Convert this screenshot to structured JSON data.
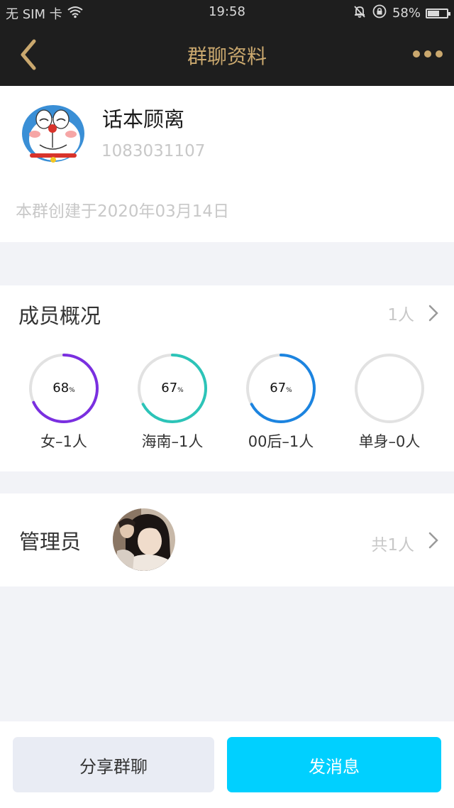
{
  "status_bar": {
    "carrier": "无 SIM 卡",
    "time": "19:58",
    "battery": "58%",
    "battery_level": 0.58
  },
  "nav": {
    "title": "群聊资料",
    "accent_color": "#caa86e"
  },
  "group": {
    "name": "话本顾离",
    "id": "1083031107",
    "created": "本群创建于2020年03月14日"
  },
  "members": {
    "title": "成员概况",
    "count": "1人",
    "stats": [
      {
        "percent": "68",
        "percent_value": 0.68,
        "color": "#7a2fe0",
        "label": "女–1人"
      },
      {
        "percent": "67",
        "percent_value": 0.67,
        "color": "#2cc4b8",
        "label": "海南–1人"
      },
      {
        "percent": "67",
        "percent_value": 0.67,
        "color": "#1c84e0",
        "label": "00后–1人"
      },
      {
        "percent": "",
        "percent_value": 0,
        "color": "#e2e2e2",
        "label": "单身–0人"
      }
    ],
    "percent_sign": "%"
  },
  "admins": {
    "title": "管理员",
    "count": "共1人"
  },
  "actions": {
    "share": "分享群聊",
    "send": "发消息"
  }
}
